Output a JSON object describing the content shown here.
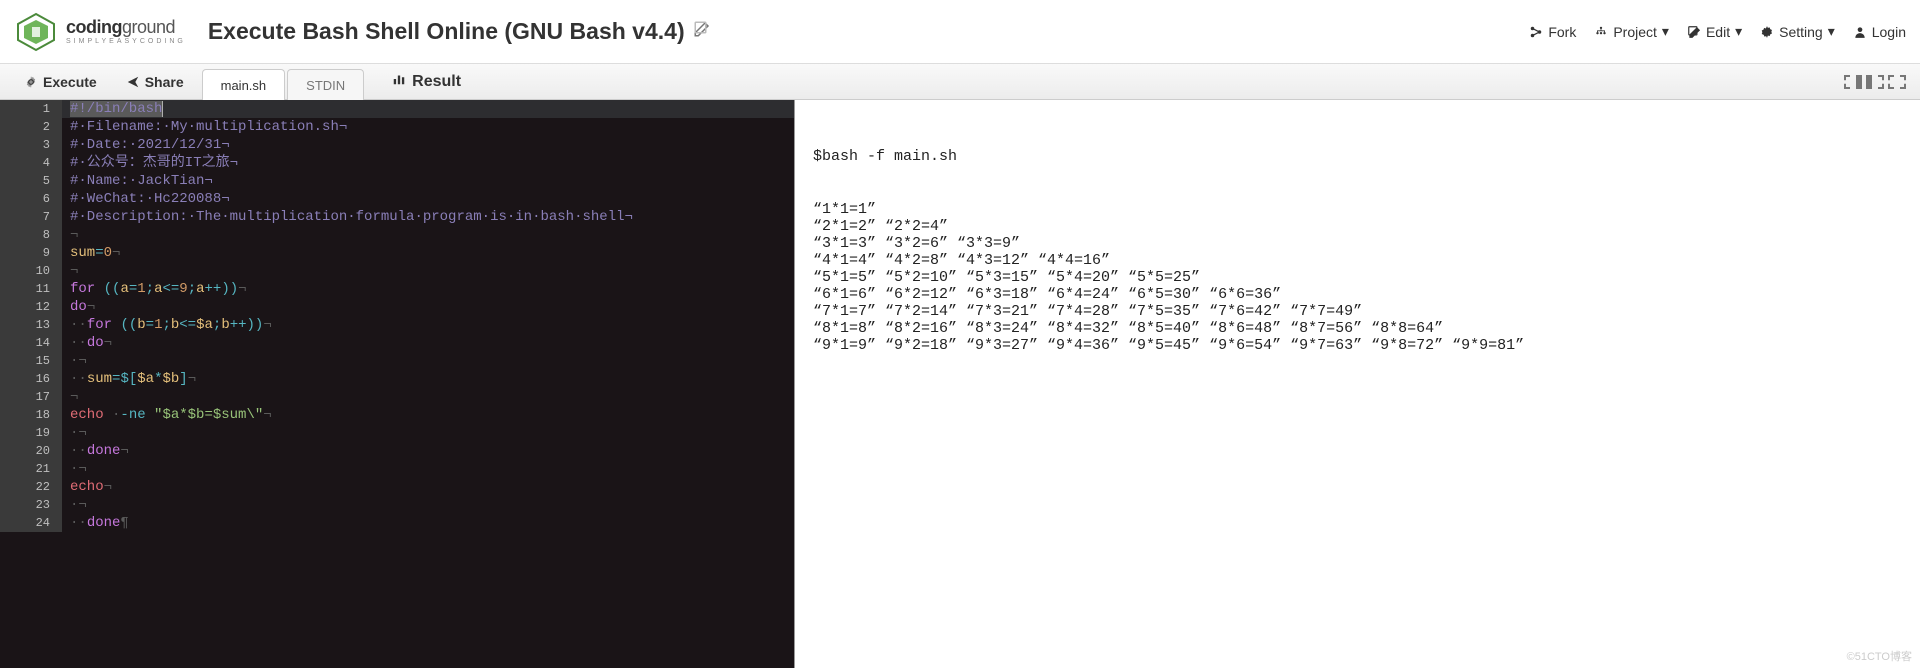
{
  "logo": {
    "main_a": "coding",
    "main_b": "ground",
    "sub": "SIMPLYEASYCODING"
  },
  "title": "Execute Bash Shell Online (GNU Bash v4.4)",
  "top_actions": {
    "fork": "Fork",
    "project": "Project",
    "edit": "Edit",
    "setting": "Setting",
    "login": "Login"
  },
  "toolbar": {
    "execute": "Execute",
    "share": "Share"
  },
  "tabs": {
    "main": "main.sh",
    "stdin": "STDIN"
  },
  "result_label": "Result",
  "code_lines": [
    {
      "n": 1,
      "type": "shebang",
      "raw": "#!/bin/bash"
    },
    {
      "n": 2,
      "type": "comment",
      "raw": "#·Filename:·My·multiplication.sh¬"
    },
    {
      "n": 3,
      "type": "comment",
      "raw": "#·Date:·2021/12/31¬"
    },
    {
      "n": 4,
      "type": "comment",
      "raw": "#·公众号：杰哥的IT之旅¬"
    },
    {
      "n": 5,
      "type": "comment",
      "raw": "#·Name:·JackTian¬"
    },
    {
      "n": 6,
      "type": "comment",
      "raw": "#·WeChat:·Hc220088¬"
    },
    {
      "n": 7,
      "type": "comment",
      "raw": "#·Description:·The·multiplication·formula·program·is·in·bash·shell¬"
    },
    {
      "n": 8,
      "type": "blank",
      "raw": "¬"
    },
    {
      "n": 9,
      "type": "assign",
      "var": "sum",
      "val": "0",
      "tail": "¬"
    },
    {
      "n": 10,
      "type": "blank",
      "raw": "¬"
    },
    {
      "n": 11,
      "type": "for",
      "expr": "a=1;a<=9;a++",
      "tail": "¬"
    },
    {
      "n": 12,
      "type": "do",
      "indent": "",
      "tail": "¬"
    },
    {
      "n": 13,
      "type": "for2",
      "indent": "··",
      "expr": "b=1;b<=$a;b++",
      "tail": "¬"
    },
    {
      "n": 14,
      "type": "do",
      "indent": "··",
      "tail": "¬"
    },
    {
      "n": 15,
      "type": "blank",
      "indent": "·",
      "raw": "¬"
    },
    {
      "n": 16,
      "type": "sumexpr",
      "indent": "··",
      "tail": "¬"
    },
    {
      "n": 17,
      "type": "blank",
      "raw": "¬"
    },
    {
      "n": 18,
      "type": "echo",
      "indent": "",
      "flag": "-ne",
      "str": "\"$a*$b=$sum\\\"",
      "tail": "¬"
    },
    {
      "n": 19,
      "type": "blank",
      "indent": "·",
      "raw": "¬"
    },
    {
      "n": 20,
      "type": "done",
      "indent": "··",
      "tail": "¬"
    },
    {
      "n": 21,
      "type": "blank",
      "indent": "·",
      "raw": "¬"
    },
    {
      "n": 22,
      "type": "echo2",
      "indent": "",
      "tail": "¬"
    },
    {
      "n": 23,
      "type": "blank",
      "indent": "·",
      "raw": "¬"
    },
    {
      "n": 24,
      "type": "done",
      "indent": "··",
      "tail": "¶"
    }
  ],
  "result": {
    "cmd": "$bash -f main.sh",
    "rows": [
      "“1*1=1”",
      "“2*1=2” “2*2=4”",
      "“3*1=3” “3*2=6” “3*3=9”",
      "“4*1=4” “4*2=8” “4*3=12” “4*4=16”",
      "“5*1=5” “5*2=10” “5*3=15” “5*4=20” “5*5=25”",
      "“6*1=6” “6*2=12” “6*3=18” “6*4=24” “6*5=30” “6*6=36”",
      "“7*1=7” “7*2=14” “7*3=21” “7*4=28” “7*5=35” “7*6=42” “7*7=49”",
      "“8*1=8” “8*2=16” “8*3=24” “8*4=32” “8*5=40” “8*6=48” “8*7=56” “8*8=64”",
      "“9*1=9” “9*2=18” “9*3=27” “9*4=36” “9*5=45” “9*6=54” “9*7=63” “9*8=72” “9*9=81”"
    ]
  },
  "watermark": "©51CTO博客"
}
